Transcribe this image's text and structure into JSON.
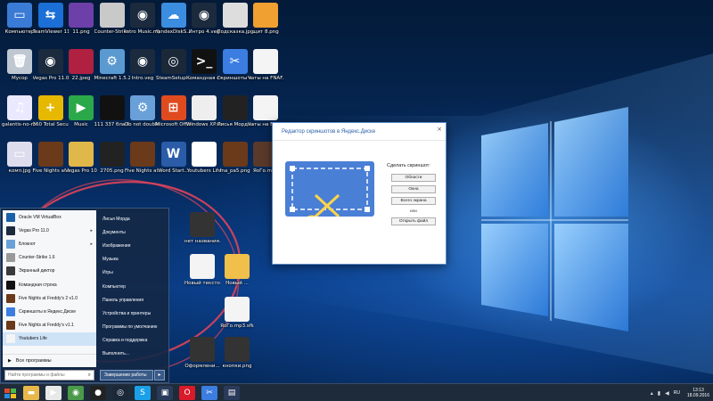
{
  "desktop": {
    "icons": [
      {
        "label": "Компьютер",
        "color": "#3a7bd5",
        "glyph": "▭"
      },
      {
        "label": "TeamViewer 11",
        "color": "#1b6fd6",
        "glyph": "⇆"
      },
      {
        "label": "11.png",
        "color": "#6d3fa8",
        "glyph": ""
      },
      {
        "label": "Counter-Strike 1.6",
        "color": "#c9c9c9",
        "glyph": ""
      },
      {
        "label": "Intro Music.mp3...",
        "color": "#1c2a3d",
        "glyph": "◉"
      },
      {
        "label": "YandexDiskS...",
        "color": "#3b8de0",
        "glyph": "☁"
      },
      {
        "label": "Интро 4.veg",
        "color": "#1c2a3d",
        "glyph": "◉"
      },
      {
        "label": "Подсказка.jpg",
        "color": "#ddd",
        "glyph": ""
      },
      {
        "label": "щит 8.png",
        "color": "#f0a030",
        "glyph": ""
      },
      {
        "label": "Мусор",
        "color": "#bfc8d2",
        "glyph": "🗑"
      },
      {
        "label": "Vegas Pro 11.0",
        "color": "#1c2a3d",
        "glyph": "◉"
      },
      {
        "label": "22.jpeg",
        "color": "#b02040",
        "glyph": ""
      },
      {
        "label": "Minecraft 1.5.2",
        "color": "#5a9ad0",
        "glyph": "⚙"
      },
      {
        "label": "Intro.veg",
        "color": "#1c2a3d",
        "glyph": "◉"
      },
      {
        "label": "SteamSetup...",
        "color": "#1b2838",
        "glyph": "◎"
      },
      {
        "label": "Командная строка",
        "color": "#111",
        "glyph": ">_"
      },
      {
        "label": "Скриншоты в Яндекс.Диске",
        "color": "#3b7de0",
        "glyph": "✂"
      },
      {
        "label": "Чаты на FNAF.txt",
        "color": "#f4f4f4",
        "glyph": ""
      },
      {
        "label": "galantis-no-money...",
        "color": "#e9e9ff",
        "glyph": "♫"
      },
      {
        "label": "360 Total Security",
        "color": "#e6b800",
        "glyph": "+"
      },
      {
        "label": "Music",
        "color": "#2ba84a",
        "glyph": "▶"
      },
      {
        "label": "111 337 бла бла.jpg",
        "color": "#111",
        "glyph": ""
      },
      {
        "label": "Do not double klick!!.bat",
        "color": "#6aa0d8",
        "glyph": "⚙"
      },
      {
        "label": "Microsoft Office 2010",
        "color": "#e04a1f",
        "glyph": "⊞"
      },
      {
        "label": "Windows XP.vdi",
        "color": "#eee",
        "glyph": ""
      },
      {
        "label": "Лисья Морда ютуб.jpg",
        "color": "#222",
        "glyph": ""
      },
      {
        "label": "Чаты на FNAF.txt",
        "color": "#f4f4f4",
        "glyph": ""
      },
      {
        "label": "комп.jpg",
        "color": "#dde",
        "glyph": "▭"
      },
      {
        "label": "Five Nights at Freddy's v1.0",
        "color": "#6a3a1a",
        "glyph": ""
      },
      {
        "label": "Vegas Pro 10",
        "color": "#e0b84a",
        "glyph": ""
      },
      {
        "label": "2705.png",
        "color": "#222",
        "glyph": ""
      },
      {
        "label": "Five Nights at Freddy's v1.0",
        "color": "#6a3a1a",
        "glyph": ""
      },
      {
        "label": "Word Start...",
        "color": "#2a5ca8",
        "glyph": "W"
      },
      {
        "label": "Youtubers Life",
        "color": "#fff",
        "glyph": "YL"
      },
      {
        "label": "fna_pa5.png",
        "color": "#6a3a1a",
        "glyph": ""
      },
      {
        "label": "ЯоГо.mp3",
        "color": "#5a3a2a",
        "glyph": ""
      }
    ],
    "mid_icons": [
      {
        "label": "нет названия.jpg",
        "color": "#333",
        "glyph": ""
      },
      {
        "label": "Новый текстов...",
        "color": "#f4f4f4",
        "glyph": ""
      },
      {
        "label": "Новый ...",
        "color": "#f0c04a",
        "glyph": ""
      },
      {
        "label": "ЯоГо.mp3.sfk",
        "color": "#f4f4f4",
        "glyph": ""
      },
      {
        "label": "Оформлени...",
        "color": "#333",
        "glyph": ""
      },
      {
        "label": "кнопки.png",
        "color": "#333",
        "glyph": ""
      }
    ]
  },
  "editor": {
    "title": "Редактор скриншотов в Яндекс.Диске",
    "close": "×",
    "prompt": "Сделать скриншот:",
    "buttons": [
      "Области",
      "Окна",
      "Всего экрана"
    ],
    "or": "или",
    "open_button": "Открыть файл"
  },
  "start_menu": {
    "left_items": [
      {
        "label": "Oracle VM VirtualBox",
        "color": "#1b5fa8",
        "arrow": ""
      },
      {
        "label": "Vegas Pro 11.0",
        "color": "#1c2a3d",
        "arrow": "▸"
      },
      {
        "label": "Блокнот",
        "color": "#6aa0d8",
        "arrow": "▸"
      },
      {
        "label": "Counter-Strike 1.6",
        "color": "#999",
        "arrow": ""
      },
      {
        "label": "Экранный диктор",
        "color": "#3a3a3a",
        "arrow": ""
      },
      {
        "label": "Командная строка",
        "color": "#111",
        "arrow": ""
      },
      {
        "label": "Five Nights at Freddy's 2 v1.0",
        "color": "#6a3a1a",
        "arrow": ""
      },
      {
        "label": "Скриншоты в Яндекс.Диске",
        "color": "#3b7de0",
        "arrow": ""
      },
      {
        "label": "Five Nights at Freddy's v1.1",
        "color": "#6a3a1a",
        "arrow": ""
      },
      {
        "label": "Youtubers Life",
        "color": "#f4f4f4",
        "arrow": ""
      }
    ],
    "all_programs": "Все программы",
    "search_placeholder": "Найти программы и файлы",
    "right_items": [
      "Лисья Морда",
      "Документы",
      "Изображения",
      "Музыка",
      "Игры",
      "Компьютер",
      "Панель управления",
      "Устройства и принтеры",
      "Программы по умолчанию",
      "Справка и поддержка",
      "Выполнить..."
    ],
    "shutdown": "Завершение работы"
  },
  "taskbar": {
    "apps": [
      {
        "name": "file-explorer",
        "color": "#e8b84a",
        "glyph": "▬"
      },
      {
        "name": "media-player",
        "color": "#e8e8e8",
        "glyph": "▶"
      },
      {
        "name": "chrome",
        "color": "#4a9a4a",
        "glyph": "◉"
      },
      {
        "name": "record-app",
        "color": "#222",
        "glyph": "●"
      },
      {
        "name": "steam",
        "color": "#1b2838",
        "glyph": "◎"
      },
      {
        "name": "skype",
        "color": "#1aa0e8",
        "glyph": "S"
      },
      {
        "name": "media-app",
        "color": "#2a3a5a",
        "glyph": "▣"
      },
      {
        "name": "opera",
        "color": "#d81a2a",
        "glyph": "O"
      },
      {
        "name": "screenshot-app",
        "color": "#3b7de0",
        "glyph": "✂"
      },
      {
        "name": "store",
        "color": "#2a3a5a",
        "glyph": "▤"
      }
    ],
    "lang": "RU",
    "time": "13:13",
    "date": "18.09.2016"
  }
}
